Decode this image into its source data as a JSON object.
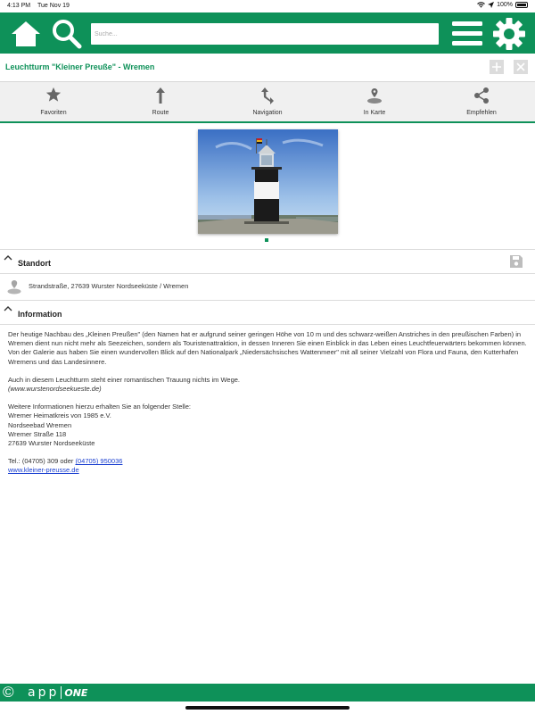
{
  "status": {
    "time": "4:13 PM",
    "date": "Tue Nov 19",
    "battery": "100%"
  },
  "header": {
    "search_placeholder": "Suche..."
  },
  "title": "Leuchtturm \"Kleiner Preuße\" - Wremen",
  "actions": [
    {
      "label": "Favoriten",
      "icon": "star-icon"
    },
    {
      "label": "Route",
      "icon": "route-arrow-icon"
    },
    {
      "label": "Navigation",
      "icon": "navigation-arrows-icon"
    },
    {
      "label": "In Karte",
      "icon": "map-pin-icon"
    },
    {
      "label": "Empfehlen",
      "icon": "share-icon"
    }
  ],
  "gallery": {
    "image": "lighthouse-photo",
    "page_count": 1,
    "current_page": 1
  },
  "standort": {
    "heading": "Standort",
    "address": "Strandstraße, 27639 Wurster Nordseeküste / Wremen"
  },
  "information": {
    "heading": "Information",
    "paragraph1": "Der heutige Nachbau des „Kleinen Preußen\" (den Namen hat er aufgrund seiner geringen Höhe von 10 m und des schwarz-weißen Anstriches in den preußischen Farben) in Wremen dient nun nicht mehr als Seezeichen, sondern als Touristenattraktion, in dessen Inneren Sie einen Einblick in das Leben eines Leuchtfeuerwärters bekommen können. Von der Galerie aus haben Sie einen wundervollen Blick auf den Nationalpark „Niedersächsisches Wattenmeer\" mit all seiner Vielzahl von Flora und Fauna, den Kutterhafen Wremens und das Landesinnere.",
    "paragraph2": "Auch in diesem Leuchtturm steht einer romantischen Trauung nichts im Wege.",
    "paragraph2_source": "(www.wurstenordseekueste.de)",
    "contact_intro": "Weitere Informationen hierzu erhalten Sie an folgender Stelle:",
    "contact_lines": [
      "Wremer Heimatkreis von 1985 e.V.",
      "Nordseebad Wremen",
      "Wremer Straße 118",
      "27639 Wurster Nordseeküste"
    ],
    "tel_label": "Tel.: (04705) 309 oder",
    "tel_link": "(04705) 950036",
    "website": "www.kleiner-preusse.de"
  },
  "footer": {
    "copyright": "©",
    "brand_left": "app",
    "brand_right": "ONE"
  },
  "colors": {
    "brand_green": "#0e9159",
    "link_blue": "#1a3fd0"
  }
}
